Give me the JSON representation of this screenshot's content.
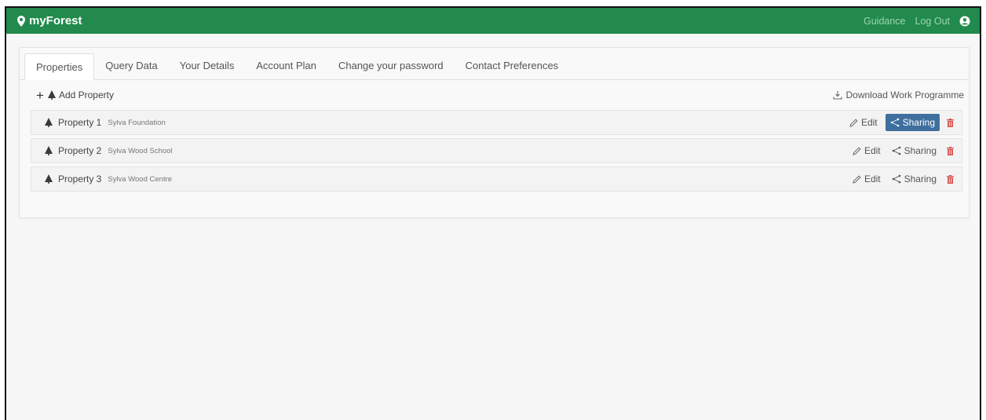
{
  "app": {
    "brand": "myForest"
  },
  "nav": {
    "guidance": "Guidance",
    "logout": "Log Out"
  },
  "tabs": [
    {
      "label": "Properties",
      "active": true
    },
    {
      "label": "Query Data"
    },
    {
      "label": "Your Details"
    },
    {
      "label": "Account Plan"
    },
    {
      "label": "Change your password"
    },
    {
      "label": "Contact Preferences"
    }
  ],
  "toolbar": {
    "add_label": "Add Property",
    "download_label": "Download Work Programme"
  },
  "properties": [
    {
      "name": "Property 1",
      "org": "Sylva Foundation",
      "sharing_active": true
    },
    {
      "name": "Property 2",
      "org": "Sylva Wood School",
      "sharing_active": false
    },
    {
      "name": "Property 3",
      "org": "Sylva Wood Centre",
      "sharing_active": false
    }
  ],
  "actions": {
    "edit": "Edit",
    "sharing": "Sharing"
  },
  "colors": {
    "navbar": "#218a4c",
    "sharing_active": "#3f6f9e",
    "delete": "#d9534f"
  }
}
